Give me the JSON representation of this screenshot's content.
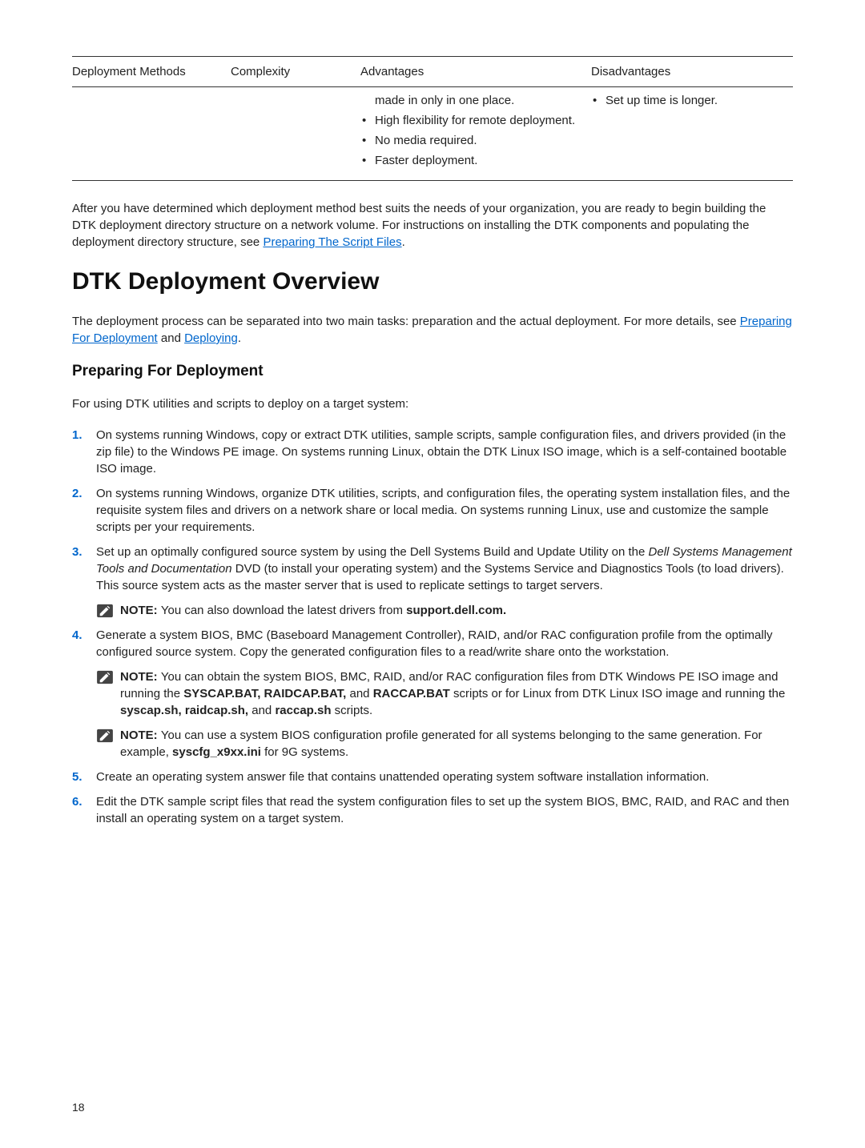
{
  "table": {
    "headers": [
      "Deployment Methods",
      "Complexity",
      "Advantages",
      "Disadvantages"
    ],
    "advantages": [
      "made in only in one place.",
      "High flexibility for remote deployment.",
      "No media required.",
      "Faster deployment."
    ],
    "disadvantages": [
      "Set up time is longer."
    ]
  },
  "intro_para_1": "After you have determined which deployment method best suits the needs of your organization, you are ready to begin building the DTK deployment directory structure on a network volume. For instructions on installing the DTK components and populating the deployment directory structure, see ",
  "intro_link_1": "Preparing The Script Files",
  "intro_para_1_end": ".",
  "h1": "DTK Deployment Overview",
  "overview_para_1": "The deployment process can be separated into two main tasks: preparation and the actual deployment. For more details, see ",
  "overview_link_1": "Preparing For Deployment",
  "overview_mid": " and ",
  "overview_link_2": "Deploying",
  "overview_end": ".",
  "h2": "Preparing For Deployment",
  "prep_intro": "For using DTK utilities and scripts to deploy on a target system:",
  "steps": {
    "s1": "On systems running Windows, copy or extract DTK utilities, sample scripts, sample configuration files, and drivers provided (in the zip file) to the Windows PE image. On systems running Linux, obtain the DTK Linux ISO image, which is a self-contained bootable ISO image.",
    "s2": "On systems running Windows, organize DTK utilities, scripts, and configuration files, the operating system installation files, and the requisite system files and drivers on a network share or local media. On systems running Linux, use and customize the sample scripts per your requirements.",
    "s3_a": "Set up an optimally configured source system by using the Dell Systems Build and Update Utility on the ",
    "s3_italic": "Dell Systems Management Tools and Documentation",
    "s3_b": " DVD (to install your operating system) and the Systems Service and Diagnostics Tools (to load drivers). This source system acts as the master server that is used to replicate settings to target servers.",
    "s3_note_a": "NOTE: ",
    "s3_note_b": "You can also download the latest drivers from ",
    "s3_note_bold": "support.dell.com.",
    "s4": "Generate a system BIOS, BMC (Baseboard Management Controller), RAID, and/or RAC configuration profile from the optimally configured source system. Copy the generated configuration files to a read/write share onto the workstation.",
    "s4_note1_a": "NOTE: ",
    "s4_note1_b": "You can obtain the system BIOS, BMC, RAID, and/or RAC configuration files from DTK Windows PE ISO image and running the ",
    "s4_note1_bold1": "SYSCAP.BAT, RAIDCAP.BAT,",
    "s4_note1_c": " and ",
    "s4_note1_bold2": "RACCAP.BAT",
    "s4_note1_d": " scripts or for Linux from DTK Linux ISO image and running the ",
    "s4_note1_bold3": "syscap.sh, raidcap.sh,",
    "s4_note1_e": " and ",
    "s4_note1_bold4": "raccap.sh",
    "s4_note1_f": " scripts.",
    "s4_note2_a": "NOTE: ",
    "s4_note2_b": "You can use a system BIOS configuration profile generated for all systems belonging to the same generation. For example, ",
    "s4_note2_bold": "syscfg_x9xx.ini",
    "s4_note2_c": " for 9G systems.",
    "s5": "Create an operating system answer file that contains unattended operating system software installation information.",
    "s6": "Edit the DTK sample script files that read the system configuration files to set up the system BIOS, BMC, RAID, and RAC and then install an operating system on a target system."
  },
  "pagenum": "18"
}
